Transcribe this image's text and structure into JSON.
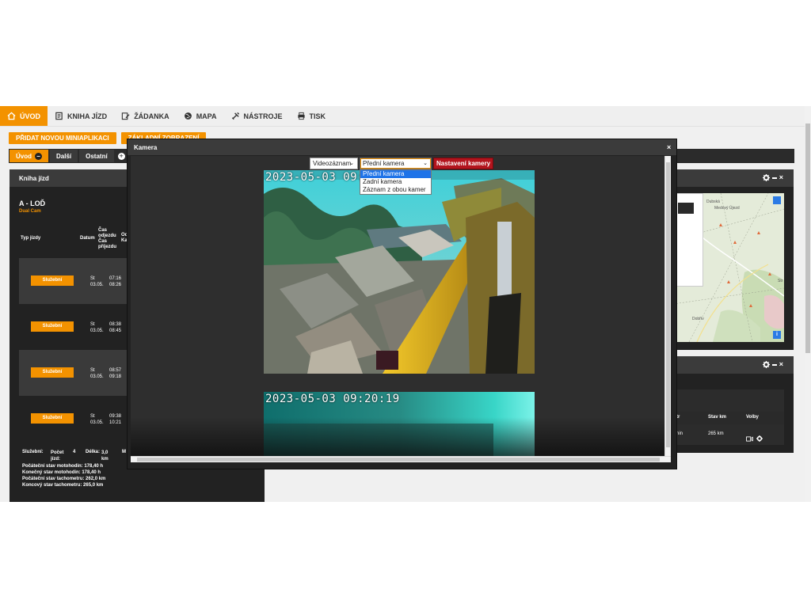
{
  "nav": [
    {
      "label": "ÚVOD",
      "icon": "home-icon",
      "active": true
    },
    {
      "label": "KNIHA JÍZD",
      "icon": "book-icon",
      "active": false
    },
    {
      "label": "ŽÁDANKA",
      "icon": "edit-form-icon",
      "active": false
    },
    {
      "label": "MAPA",
      "icon": "globe-icon",
      "active": false
    },
    {
      "label": "NÁSTROJE",
      "icon": "tools-icon",
      "active": false
    },
    {
      "label": "TISK",
      "icon": "print-icon",
      "active": false
    }
  ],
  "buttons": {
    "add_widget": "PŘIDAT NOVOU MINIAPLIKACI",
    "default_view": "ZÁKLADNÍ ZOBRAZENÍ"
  },
  "tabs": [
    {
      "label": "Úvod",
      "active": true
    },
    {
      "label": "Další",
      "active": false
    },
    {
      "label": "Ostatní",
      "active": false
    }
  ],
  "logbook": {
    "title": "Kniha jízd",
    "vehicle": "A - LOĎ",
    "device": "Dual Cam",
    "headers": {
      "type": "Typ jízdy",
      "date": "Datum",
      "times": "Čas odjezdu Čas příjezdu",
      "dest": "Od Ka"
    },
    "rows": [
      {
        "type": "Služební",
        "day": "St",
        "date": "03.05.",
        "depart": "07:16",
        "arrive": "08:26"
      },
      {
        "type": "Služební",
        "day": "St",
        "date": "03.05.",
        "depart": "08:38",
        "arrive": "08:45"
      },
      {
        "type": "Služební",
        "day": "St",
        "date": "03.05.",
        "depart": "08:57",
        "arrive": "09:18"
      },
      {
        "type": "Služební",
        "day": "St",
        "date": "03.05.",
        "depart": "09:38",
        "arrive": "10:21"
      }
    ],
    "summary": {
      "type_label": "Služební:",
      "count_label": "Počet jízd:",
      "count": "4",
      "length_label": "Délka:",
      "length": "3,0 km",
      "extra": "M",
      "lines": [
        "Počáteční stav motohodin: 178,40 h",
        "Konečný stav motohodin: 178,40 h",
        "Počáteční stav tachometru: 262,0 km",
        "Koncový stav tachometru: 265,0 km"
      ]
    }
  },
  "map": {
    "labels": [
      "Dubská",
      "Medový Újezd",
      "Dobřív",
      "Str"
    ],
    "info": "i"
  },
  "right_table": {
    "headers": [
      "tr",
      "Stav km",
      "Volby"
    ],
    "row": {
      "time": "nin",
      "km": "265 km"
    }
  },
  "modal": {
    "title": "Kamera",
    "mode_select": "Videozáznam",
    "camera_select": "Přední kamera",
    "camera_options": [
      "Přední kamera",
      "Zadní kamera",
      "Záznam z obou kamer"
    ],
    "settings_button": "Nastavení kamery",
    "videos": [
      {
        "timestamp": "2023-05-03 09:"
      },
      {
        "timestamp": "2023-05-03 09:20:19"
      }
    ]
  }
}
